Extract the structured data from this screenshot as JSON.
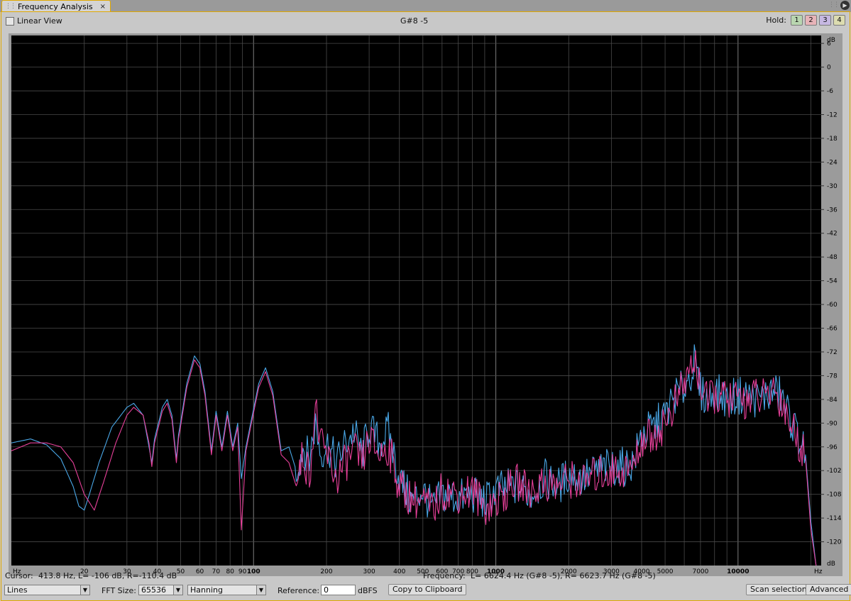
{
  "window": {
    "tab_title": "Frequency Analysis",
    "close_glyph": "×",
    "menu_glyph": "▶"
  },
  "top_bar": {
    "linear_view_label": "Linear View",
    "linear_view_checked": false,
    "note_readout": "G#8 -5",
    "hold_label": "Hold:",
    "hold_buttons": [
      {
        "label": "1",
        "color": "#b9d6b0"
      },
      {
        "label": "2",
        "color": "#e7b3b8"
      },
      {
        "label": "3",
        "color": "#c6b8e2"
      },
      {
        "label": "4",
        "color": "#dcdcb0"
      }
    ]
  },
  "status": {
    "cursor_label": "Cursor:",
    "cursor_value": "413.8 Hz, L=  -106 dB, R=-110.4 dB",
    "frequency_label": "Frequency:",
    "frequency_value": "L= 6624.4 Hz (G#8 -5), R= 6623.7 Hz (G#8 -5)"
  },
  "controls": {
    "display_mode": "Lines",
    "fft_size_label": "FFT Size:",
    "fft_size": "65536",
    "window_function": "Hanning",
    "reference_label": "Reference:",
    "reference_value": "0",
    "reference_unit": "dBFS",
    "copy_button": "Copy to Clipboard",
    "scan_button": "Scan selection",
    "advanced_button": "Advanced"
  },
  "colors": {
    "plot_bg": "#000000",
    "grid": "#4a4a4a",
    "left_channel": "#4aa8e8",
    "right_channel": "#e8409a",
    "accent": "#e0a800"
  },
  "chart_data": {
    "type": "line",
    "x_scale": "log",
    "xlim": [
      10,
      22050
    ],
    "ylim": [
      -126,
      8
    ],
    "x_unit_label": "Hz",
    "y_unit_label": "dB",
    "x_tick_labels": [
      {
        "value": 20,
        "label": "20"
      },
      {
        "value": 30,
        "label": "30"
      },
      {
        "value": 40,
        "label": "40"
      },
      {
        "value": 50,
        "label": "50"
      },
      {
        "value": 60,
        "label": "60"
      },
      {
        "value": 70,
        "label": "70"
      },
      {
        "value": 80,
        "label": "80"
      },
      {
        "value": 90,
        "label": "90"
      },
      {
        "value": 100,
        "label": "100"
      },
      {
        "value": 200,
        "label": "200"
      },
      {
        "value": 300,
        "label": "300"
      },
      {
        "value": 400,
        "label": "400"
      },
      {
        "value": 500,
        "label": "500"
      },
      {
        "value": 600,
        "label": "600"
      },
      {
        "value": 700,
        "label": "700"
      },
      {
        "value": 800,
        "label": "800"
      },
      {
        "value": 1000,
        "label": "1000"
      },
      {
        "value": 2000,
        "label": "2000"
      },
      {
        "value": 3000,
        "label": "3000"
      },
      {
        "value": 4000,
        "label": "4000"
      },
      {
        "value": 5000,
        "label": "5000"
      },
      {
        "value": 7000,
        "label": "7000"
      },
      {
        "value": 10000,
        "label": "10000"
      }
    ],
    "x_bold_ticks": [
      100,
      1000,
      10000
    ],
    "y_ticks": [
      6,
      0,
      -6,
      -12,
      -18,
      -24,
      -30,
      -36,
      -42,
      -48,
      -54,
      -60,
      -66,
      -72,
      -78,
      -84,
      -90,
      -96,
      -102,
      -108,
      -114,
      -120
    ],
    "grid": true,
    "series": [
      {
        "color": "#4aa8e8",
        "points": [
          [
            10,
            -95
          ],
          [
            12,
            -94
          ],
          [
            14,
            -95.5
          ],
          [
            16,
            -99
          ],
          [
            18,
            -106
          ],
          [
            19,
            -111
          ],
          [
            20,
            -112
          ],
          [
            21,
            -108
          ],
          [
            23,
            -100
          ],
          [
            26,
            -91
          ],
          [
            30,
            -86
          ],
          [
            32,
            -85
          ],
          [
            35,
            -88
          ],
          [
            37,
            -96
          ],
          [
            38,
            -100
          ],
          [
            39,
            -94
          ],
          [
            42,
            -86
          ],
          [
            44,
            -84
          ],
          [
            46,
            -88
          ],
          [
            48,
            -99
          ],
          [
            49,
            -93
          ],
          [
            53,
            -80
          ],
          [
            57,
            -73
          ],
          [
            60,
            -75
          ],
          [
            63,
            -82
          ],
          [
            67,
            -97
          ],
          [
            70,
            -87
          ],
          [
            74,
            -96
          ],
          [
            78,
            -87
          ],
          [
            82,
            -96
          ],
          [
            86,
            -90
          ],
          [
            89,
            -104
          ],
          [
            93,
            -96
          ],
          [
            98,
            -89
          ],
          [
            105,
            -80
          ],
          [
            112,
            -76
          ],
          [
            120,
            -82
          ],
          [
            130,
            -97
          ],
          [
            140,
            -96
          ],
          [
            150,
            -102
          ],
          [
            160,
            -96
          ],
          [
            170,
            -99
          ],
          [
            180,
            -90
          ],
          [
            190,
            -98
          ],
          [
            200,
            -95
          ],
          [
            220,
            -100
          ],
          [
            240,
            -95
          ],
          [
            260,
            -92
          ],
          [
            280,
            -98
          ],
          [
            300,
            -91
          ],
          [
            330,
            -95
          ],
          [
            360,
            -92
          ],
          [
            400,
            -104
          ],
          [
            450,
            -110
          ],
          [
            500,
            -107
          ],
          [
            550,
            -112
          ],
          [
            600,
            -108
          ],
          [
            700,
            -109
          ],
          [
            800,
            -108
          ],
          [
            900,
            -110
          ],
          [
            1000,
            -107
          ],
          [
            1200,
            -106
          ],
          [
            1400,
            -108
          ],
          [
            1600,
            -104
          ],
          [
            1800,
            -106
          ],
          [
            2000,
            -103
          ],
          [
            2300,
            -104
          ],
          [
            2600,
            -102
          ],
          [
            3000,
            -101
          ],
          [
            3400,
            -101
          ],
          [
            3700,
            -100
          ],
          [
            4000,
            -93
          ],
          [
            4500,
            -91
          ],
          [
            5000,
            -88
          ],
          [
            5500,
            -83
          ],
          [
            6000,
            -81
          ],
          [
            6600,
            -75
          ],
          [
            7000,
            -82
          ],
          [
            7500,
            -84
          ],
          [
            8000,
            -82
          ],
          [
            9000,
            -84
          ],
          [
            10000,
            -83
          ],
          [
            11000,
            -83
          ],
          [
            12000,
            -84
          ],
          [
            13000,
            -83
          ],
          [
            14000,
            -82
          ],
          [
            15000,
            -83
          ],
          [
            16000,
            -87
          ],
          [
            17000,
            -91
          ],
          [
            18000,
            -94
          ],
          [
            19000,
            -98
          ],
          [
            20000,
            -115
          ],
          [
            21000,
            -126
          ]
        ]
      },
      {
        "color": "#e8409a",
        "points": [
          [
            10,
            -97
          ],
          [
            12,
            -95
          ],
          [
            14,
            -95
          ],
          [
            16,
            -96
          ],
          [
            18,
            -100
          ],
          [
            20,
            -108
          ],
          [
            22,
            -112
          ],
          [
            24,
            -105
          ],
          [
            27,
            -95
          ],
          [
            30,
            -88
          ],
          [
            32,
            -86
          ],
          [
            35,
            -88
          ],
          [
            37,
            -95
          ],
          [
            38,
            -101
          ],
          [
            39,
            -95
          ],
          [
            42,
            -87
          ],
          [
            44,
            -85
          ],
          [
            46,
            -89
          ],
          [
            48,
            -100
          ],
          [
            49,
            -94
          ],
          [
            53,
            -81
          ],
          [
            57,
            -74
          ],
          [
            60,
            -76
          ],
          [
            63,
            -83
          ],
          [
            67,
            -98
          ],
          [
            70,
            -88
          ],
          [
            74,
            -97
          ],
          [
            78,
            -88
          ],
          [
            82,
            -97
          ],
          [
            86,
            -91
          ],
          [
            89,
            -117
          ],
          [
            93,
            -97
          ],
          [
            98,
            -90
          ],
          [
            105,
            -81
          ],
          [
            112,
            -77
          ],
          [
            120,
            -83
          ],
          [
            130,
            -98
          ],
          [
            140,
            -100
          ],
          [
            150,
            -106
          ],
          [
            160,
            -98
          ],
          [
            170,
            -103
          ],
          [
            180,
            -86
          ],
          [
            190,
            -96
          ],
          [
            200,
            -98
          ],
          [
            220,
            -104
          ],
          [
            240,
            -100
          ],
          [
            260,
            -97
          ],
          [
            280,
            -100
          ],
          [
            300,
            -94
          ],
          [
            330,
            -98
          ],
          [
            360,
            -96
          ],
          [
            400,
            -106
          ],
          [
            450,
            -109
          ],
          [
            500,
            -110
          ],
          [
            550,
            -112
          ],
          [
            600,
            -107
          ],
          [
            700,
            -108
          ],
          [
            800,
            -107
          ],
          [
            900,
            -111
          ],
          [
            1000,
            -110
          ],
          [
            1200,
            -105
          ],
          [
            1400,
            -107
          ],
          [
            1600,
            -105
          ],
          [
            1800,
            -106
          ],
          [
            2000,
            -104
          ],
          [
            2300,
            -105
          ],
          [
            2600,
            -103
          ],
          [
            3000,
            -102
          ],
          [
            3400,
            -102
          ],
          [
            3700,
            -101
          ],
          [
            4000,
            -94
          ],
          [
            4500,
            -93
          ],
          [
            5000,
            -90
          ],
          [
            5500,
            -85
          ],
          [
            6000,
            -80
          ],
          [
            6600,
            -74
          ],
          [
            7000,
            -80
          ],
          [
            7500,
            -85
          ],
          [
            8000,
            -83
          ],
          [
            9000,
            -84
          ],
          [
            10000,
            -84
          ],
          [
            11000,
            -84
          ],
          [
            12000,
            -83
          ],
          [
            13000,
            -84
          ],
          [
            14000,
            -81
          ],
          [
            15000,
            -84
          ],
          [
            16000,
            -88
          ],
          [
            17000,
            -92
          ],
          [
            18000,
            -95
          ],
          [
            19000,
            -99
          ],
          [
            20000,
            -117
          ],
          [
            21000,
            -126
          ]
        ]
      }
    ]
  }
}
